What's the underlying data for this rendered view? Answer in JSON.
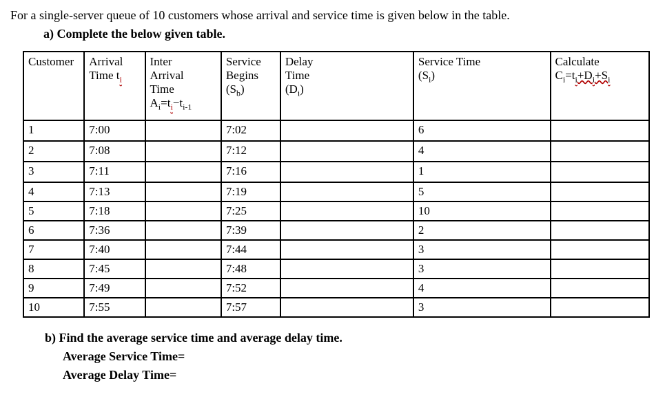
{
  "intro": "For a single-server queue of 10 customers whose arrival and service time is given below in the table.",
  "partA": "a) Complete the below given table.",
  "headers": {
    "customer": "Customer",
    "arrival_main": "Arrival",
    "arrival_sub_prefix": "Time t",
    "arrival_sub_suffix": "i",
    "inter_main": "Inter",
    "inter_sub1": "Arrival",
    "inter_sub2": "Time",
    "inter_formula_lhs": "A",
    "inter_formula_sub1": "i",
    "inter_formula_mid": "=t",
    "inter_formula_sub2": "i",
    "inter_formula_dash": "−t",
    "inter_formula_sub3": "i-1",
    "begins_main": "Service",
    "begins_sub1": "Begins",
    "begins_sub2_prefix": "(S",
    "begins_sub2_sub": "b",
    "begins_sub2_suffix": ")",
    "delay_main": "Delay",
    "delay_sub1": "Time",
    "delay_sub2_prefix": "(D",
    "delay_sub2_sub": "i",
    "delay_sub2_suffix": ")",
    "service_main": "Service Time",
    "service_sub_prefix": "(S",
    "service_sub_sub": "i",
    "service_sub_suffix": ")",
    "calc_main": "Calculate",
    "calc_formula_c": "C",
    "calc_formula_sub1": "i",
    "calc_formula_eq": "=t",
    "calc_formula_sub2": "i",
    "calc_formula_plus1": "+D",
    "calc_formula_sub3": "i",
    "calc_formula_plus2": "+S",
    "calc_formula_sub4": "i"
  },
  "rows": [
    {
      "customer": "1",
      "arrival": "7:00",
      "inter": "",
      "begins": "7:02",
      "delay": "",
      "service": "6",
      "calc": ""
    },
    {
      "customer": "2",
      "arrival": "7:08",
      "inter": "",
      "begins": "7:12",
      "delay": "",
      "service": "4",
      "calc": ""
    },
    {
      "customer": "3",
      "arrival": "7:11",
      "inter": "",
      "begins": "7:16",
      "delay": "",
      "service": "1",
      "calc": ""
    },
    {
      "customer": "4",
      "arrival": "7:13",
      "inter": "",
      "begins": "7:19",
      "delay": "",
      "service": "5",
      "calc": ""
    },
    {
      "customer": "5",
      "arrival": "7:18",
      "inter": "",
      "begins": "7:25",
      "delay": "",
      "service": "10",
      "calc": ""
    },
    {
      "customer": "6",
      "arrival": "7:36",
      "inter": "",
      "begins": "7:39",
      "delay": "",
      "service": "2",
      "calc": ""
    },
    {
      "customer": "7",
      "arrival": "7:40",
      "inter": "",
      "begins": "7:44",
      "delay": "",
      "service": "3",
      "calc": ""
    },
    {
      "customer": "8",
      "arrival": "7:45",
      "inter": "",
      "begins": "7:48",
      "delay": "",
      "service": "3",
      "calc": ""
    },
    {
      "customer": "9",
      "arrival": "7:49",
      "inter": "",
      "begins": "7:52",
      "delay": "",
      "service": "4",
      "calc": ""
    },
    {
      "customer": "10",
      "arrival": "7:55",
      "inter": "",
      "begins": "7:57",
      "delay": "",
      "service": "3",
      "calc": ""
    }
  ],
  "partB": "b) Find the average service time and average delay time.",
  "avgServiceLabel": "Average Service Time=",
  "avgDelayLabel": "Average Delay Time="
}
